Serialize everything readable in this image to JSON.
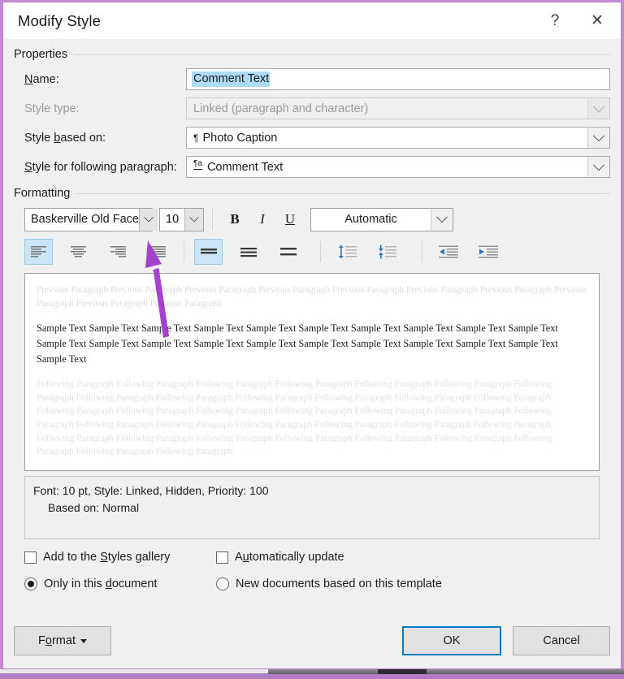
{
  "window": {
    "title": "Modify Style",
    "help_icon": "?",
    "close_icon": "✕"
  },
  "properties": {
    "group_label": "Properties",
    "fields": [
      {
        "label_pre": "",
        "label_key": "N",
        "label_post": "ame:",
        "label_full": "Name:",
        "value": "Comment Text",
        "disabled": false,
        "selected": true,
        "glyph": ""
      },
      {
        "label_full": "Style type:",
        "value": "Linked (paragraph and character)",
        "disabled": true,
        "selected": false,
        "glyph": ""
      },
      {
        "label_full": "Style based on:",
        "value": "Photo Caption",
        "disabled": false,
        "selected": false,
        "glyph": "¶"
      },
      {
        "label_full": "Style for following paragraph:",
        "value": "Comment Text",
        "disabled": false,
        "selected": false,
        "glyph": "¶a"
      }
    ]
  },
  "formatting": {
    "group_label": "Formatting",
    "font_family": "Baskerville Old Face",
    "font_size": "10",
    "bold_label": "B",
    "italic_label": "I",
    "underline_label": "U",
    "font_color": "Automatic",
    "align_buttons": [
      {
        "name": "align-left",
        "active": true
      },
      {
        "name": "align-center",
        "active": false
      },
      {
        "name": "align-right",
        "active": false
      },
      {
        "name": "align-justify",
        "active": false
      }
    ],
    "linespacing_buttons": [
      {
        "name": "line-spacing-single",
        "active": true
      },
      {
        "name": "line-spacing-1-5",
        "active": false
      },
      {
        "name": "line-spacing-double",
        "active": false
      }
    ],
    "spacing_buttons": [
      {
        "name": "increase-paragraph-spacing",
        "active": false
      },
      {
        "name": "decrease-paragraph-spacing",
        "active": false
      }
    ],
    "indent_buttons": [
      {
        "name": "decrease-indent",
        "active": false
      },
      {
        "name": "increase-indent",
        "active": false
      }
    ]
  },
  "preview": {
    "previous_paragraph": "Previous Paragraph Previous Paragraph Previous Paragraph Previous Paragraph Previous Paragraph Previous Paragraph Previous Paragraph Previous Paragraph Previous Paragraph Previous Paragraph",
    "sample_text": "Sample Text Sample Text Sample Text Sample Text Sample Text Sample Text Sample Text Sample Text Sample Text Sample Text Sample Text Sample Text Sample Text Sample Text Sample Text Sample Text Sample Text Sample Text Sample Text Sample Text Sample Text",
    "following_paragraph": "Following Paragraph Following Paragraph Following Paragraph Following Paragraph Following Paragraph Following Paragraph Following Paragraph Following Paragraph Following Paragraph Following Paragraph Following Paragraph Following Paragraph Following Paragraph Following Paragraph Following Paragraph Following Paragraph Following Paragraph Following Paragraph Following Paragraph Following Paragraph Following Paragraph Following Paragraph Following Paragraph Following Paragraph Following Paragraph Following Paragraph Following Paragraph Following Paragraph Following Paragraph Following Paragraph Following Paragraph Following Paragraph Following Paragraph Following Paragraph Following Paragraph"
  },
  "description": {
    "line1": "Font: 10 pt, Style: Linked, Hidden, Priority: 100",
    "line2": "Based on: Normal"
  },
  "options": {
    "add_to_gallery": {
      "label": "Add to the Styles gallery",
      "checked": false
    },
    "auto_update": {
      "label": "Automatically update",
      "checked": false
    },
    "only_this_document": {
      "label": "Only in this document",
      "checked": true
    },
    "new_documents": {
      "label": "New documents based on this template",
      "checked": false
    }
  },
  "footer": {
    "format_label": "Format",
    "ok_label": "OK",
    "cancel_label": "Cancel"
  },
  "annotation": {
    "arrow_color": "#a541cf"
  },
  "colors": {
    "dialog_border": "#c37fd2",
    "accent_selection": "#addaf7",
    "focus_blue": "#0a7ac4",
    "icon_blue": "#2e74b5"
  }
}
